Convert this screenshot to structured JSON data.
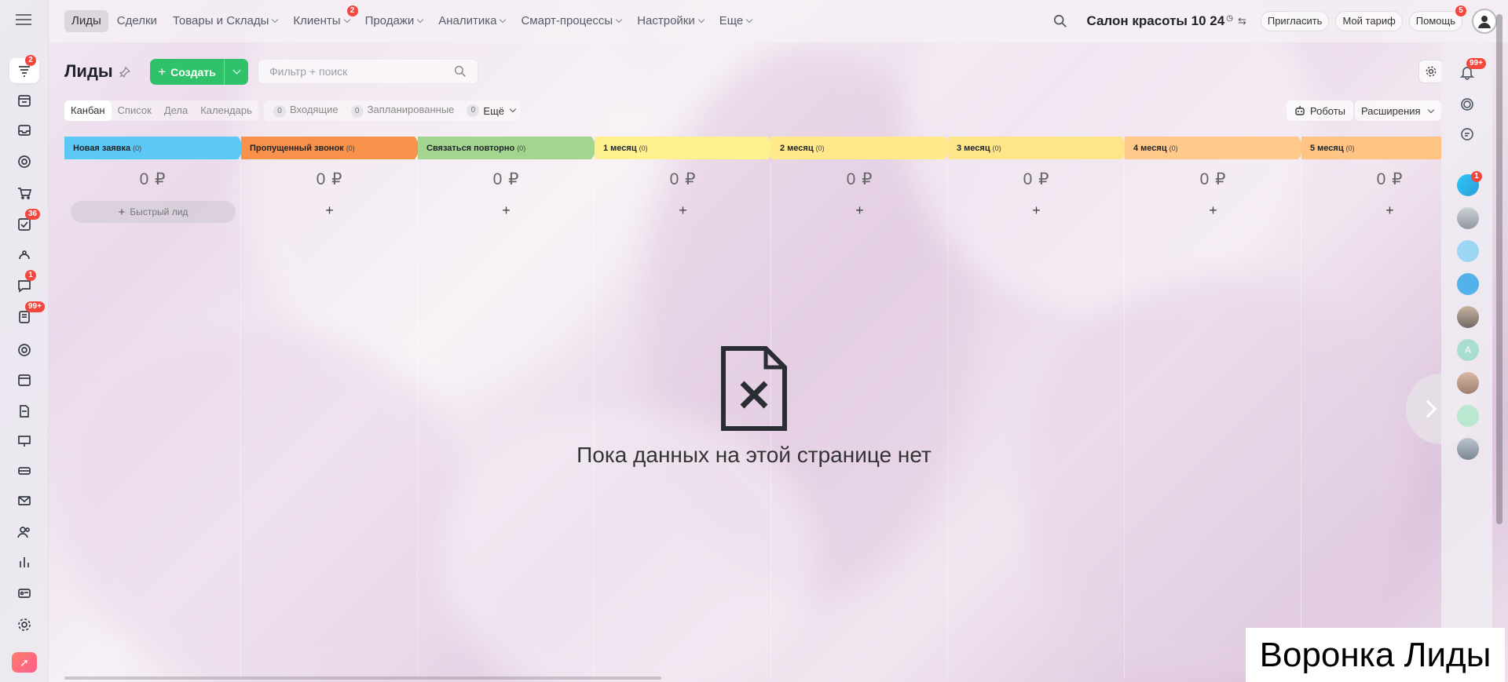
{
  "topnav": {
    "items": [
      {
        "label": "Лиды",
        "active": true,
        "dropdown": false,
        "badge": ""
      },
      {
        "label": "Сделки",
        "active": false,
        "dropdown": false,
        "badge": ""
      },
      {
        "label": "Товары и Склады",
        "active": false,
        "dropdown": true,
        "badge": ""
      },
      {
        "label": "Клиенты",
        "active": false,
        "dropdown": true,
        "badge": "2"
      },
      {
        "label": "Продажи",
        "active": false,
        "dropdown": true,
        "badge": ""
      },
      {
        "label": "Аналитика",
        "active": false,
        "dropdown": true,
        "badge": ""
      },
      {
        "label": "Смарт-процессы",
        "active": false,
        "dropdown": true,
        "badge": ""
      },
      {
        "label": "Настройки",
        "active": false,
        "dropdown": true,
        "badge": ""
      },
      {
        "label": "Еще",
        "active": false,
        "dropdown": true,
        "badge": ""
      }
    ],
    "company": "Салон красоты 10 24",
    "invite": "Пригласить",
    "tariff": "Мой тариф",
    "help": "Помощь",
    "help_badge": "5"
  },
  "left_sidebar": {
    "items": [
      {
        "icon": "funnel-icon",
        "badge": "2",
        "active": true
      },
      {
        "icon": "calendar-list-icon",
        "badge": "",
        "active": false
      },
      {
        "icon": "inbox-icon",
        "badge": "",
        "active": false
      },
      {
        "icon": "target-icon",
        "badge": "",
        "active": false
      },
      {
        "icon": "cart-icon",
        "badge": "",
        "active": false
      },
      {
        "icon": "tasks-icon",
        "badge": "36",
        "active": false
      },
      {
        "icon": "automation-icon",
        "badge": "",
        "active": false
      },
      {
        "icon": "chat-icon",
        "badge": "1",
        "active": false
      },
      {
        "icon": "feed-icon",
        "badge": "99+",
        "active": false
      },
      {
        "icon": "lifebuoy-icon",
        "badge": "",
        "active": false
      },
      {
        "icon": "calendar-icon",
        "badge": "",
        "active": false
      },
      {
        "icon": "document-icon",
        "badge": "",
        "active": false
      },
      {
        "icon": "presentation-icon",
        "badge": "",
        "active": false
      },
      {
        "icon": "drive-icon",
        "badge": "",
        "active": false
      },
      {
        "icon": "mail-icon",
        "badge": "",
        "active": false
      },
      {
        "icon": "team-icon",
        "badge": "",
        "active": false
      },
      {
        "icon": "bar-chart-icon",
        "badge": "",
        "active": false
      },
      {
        "icon": "id-card-icon",
        "badge": "",
        "active": false
      },
      {
        "icon": "settings-icon",
        "badge": "",
        "active": false
      }
    ]
  },
  "header": {
    "title": "Лиды",
    "create_label": "Создать",
    "search_placeholder": "Фильтр + поиск"
  },
  "views": [
    "Канбан",
    "Список",
    "Дела",
    "Календарь"
  ],
  "counters": [
    {
      "count": "0",
      "label": "Входящие"
    },
    {
      "count": "0",
      "label": "Запланированные"
    },
    {
      "count": "0",
      "label": "Ещё"
    }
  ],
  "robots_label": "Роботы",
  "extensions_label": "Расширения",
  "stages": [
    {
      "name": "Новая заявка",
      "count": "(0)",
      "sum": "0 ₽",
      "color": "#5bc8f5"
    },
    {
      "name": "Пропущенный звонок",
      "count": "(0)",
      "sum": "0 ₽",
      "color": "#f8914a"
    },
    {
      "name": "Связаться повторно",
      "count": "(0)",
      "sum": "0 ₽",
      "color": "#a4d58f"
    },
    {
      "name": "1 месяц",
      "count": "(0)",
      "sum": "0 ₽",
      "color": "#fff08f"
    },
    {
      "name": "2 месяц",
      "count": "(0)",
      "sum": "0 ₽",
      "color": "#ffe98a"
    },
    {
      "name": "3 месяц",
      "count": "(0)",
      "sum": "0 ₽",
      "color": "#ffe58a"
    },
    {
      "name": "4 месяц",
      "count": "(0)",
      "sum": "0 ₽",
      "color": "#ffc98a"
    },
    {
      "name": "5 месяц",
      "count": "(0)",
      "sum": "0 ₽",
      "color": "#ffc384"
    }
  ],
  "quick_lead": "Быстрый лид",
  "add_symbol": "+",
  "empty_text": "Пока данных на этой странице нет",
  "right_bar": {
    "notifications_badge": "99+",
    "chat_badge": "1",
    "avatar_letter": "A"
  },
  "caption": "Воронка Лиды"
}
